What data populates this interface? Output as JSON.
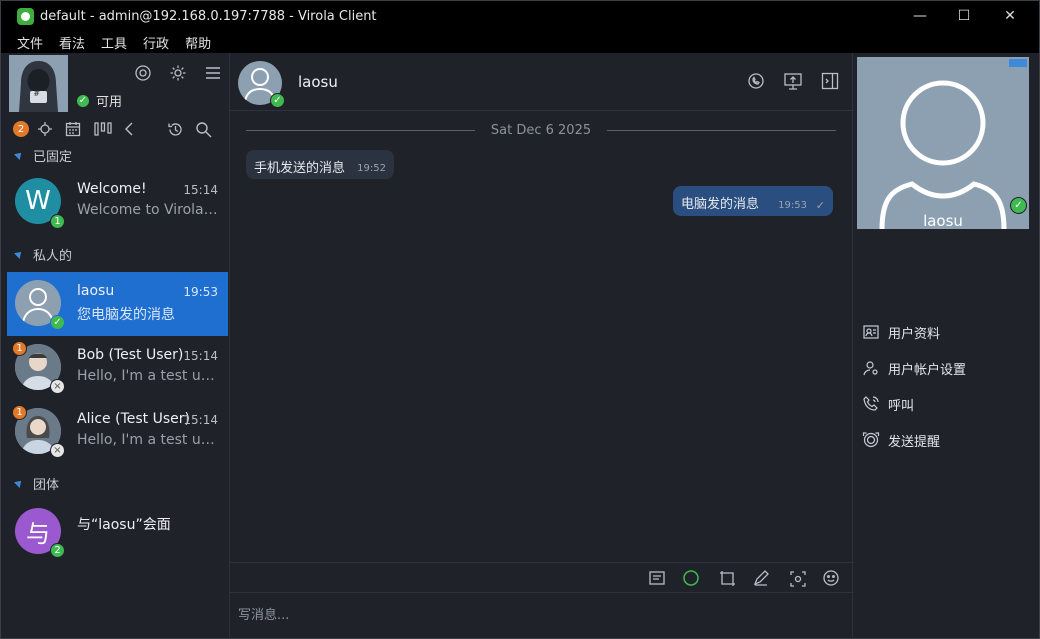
{
  "window": {
    "title": "default - admin@192.168.0.197:7788 - Virola Client",
    "minimize": "—",
    "maximize": "☐",
    "close": "✕"
  },
  "menu": [
    "文件",
    "看法",
    "工具",
    "行政",
    "帮助"
  ],
  "self": {
    "status": "可用",
    "avatar_text": "#"
  },
  "toolbar": {
    "notification_count": "2"
  },
  "sections": {
    "pinned": "已固定",
    "private": "私人的",
    "groups": "团体"
  },
  "chats": [
    {
      "initial": "W",
      "name": "Welcome!",
      "time": "15:14",
      "preview": "Welcome to Virola ...",
      "badge": "1",
      "avatar_color": "#1f8ea3"
    },
    {
      "name": "laosu",
      "time": "19:53",
      "preview": "您电脑发的消息",
      "active": true
    },
    {
      "name": "Bob (Test User)",
      "time": "15:14",
      "preview": "Hello, I'm a test use...",
      "badge": "1"
    },
    {
      "name": "Alice (Test User)",
      "time": "15:14",
      "preview": "Hello, I'm a test use...",
      "badge": "1"
    },
    {
      "initial": "与",
      "name": "与“laosu”会面",
      "badge": "2",
      "avatar_color": "#9b59d0"
    }
  ],
  "conversation": {
    "name": "laosu",
    "date": "Sat Dec 6 2025",
    "messages": [
      {
        "text": "手机发送的消息",
        "time": "19:52",
        "direction": "in"
      },
      {
        "text": "电脑发的消息",
        "time": "19:53",
        "direction": "out"
      }
    ],
    "composer_placeholder": "写消息..."
  },
  "profile": {
    "name": "laosu",
    "actions": [
      "用户资料",
      "用户帐户设置",
      "呼叫",
      "发送提醒"
    ]
  },
  "colors": {
    "accent": "#1f6fd0",
    "online": "#3fb950",
    "badge": "#e07a2a"
  }
}
